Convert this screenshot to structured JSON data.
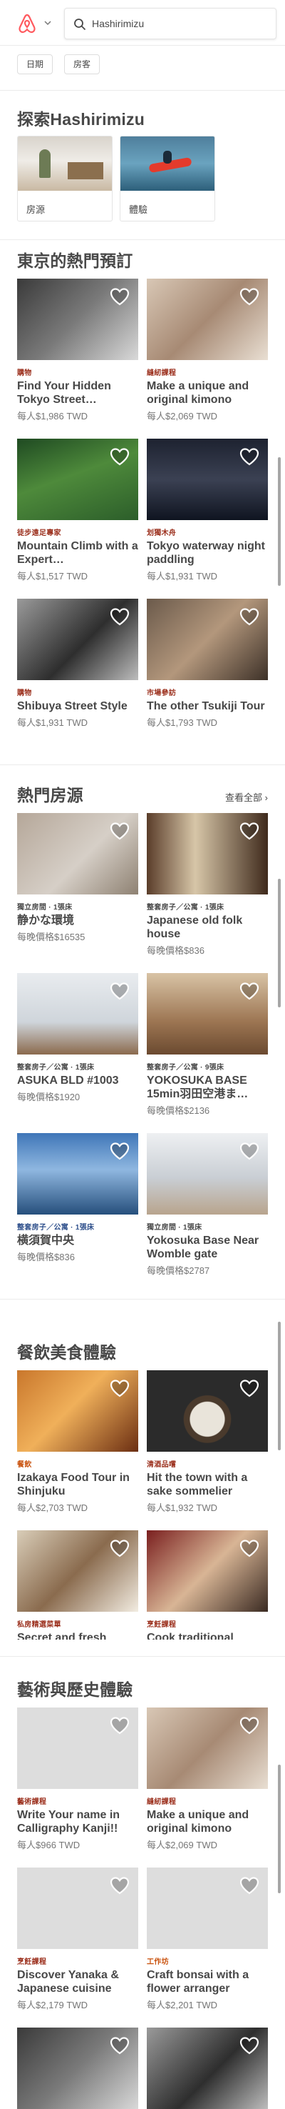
{
  "search": {
    "value": "Hashirimizu",
    "placeholder": ""
  },
  "filters": [
    {
      "label": "日期"
    },
    {
      "label": "房客"
    }
  ],
  "explore": {
    "title": "探索Hashirimizu",
    "categories": [
      {
        "label": "房源"
      },
      {
        "label": "體驗"
      }
    ]
  },
  "popular": {
    "title": "東京的熱門預訂",
    "cards": [
      {
        "label": "購物",
        "title": "Find Your Hidden Tokyo Street…",
        "price": "每人$1,986 TWD"
      },
      {
        "label": "縫紉課程",
        "title": "Make a unique and original kimono",
        "price": "每人$2,069 TWD"
      },
      {
        "label": "徒步遠足專家",
        "title": "Mountain Climb with a Expert…",
        "price": "每人$1,517 TWD"
      },
      {
        "label": "划獨木舟",
        "title": "Tokyo waterway night paddling",
        "price": "每人$1,931 TWD"
      },
      {
        "label": "購物",
        "title": "Shibuya Street Style",
        "price": "每人$1,931 TWD"
      },
      {
        "label": "市場參訪",
        "title": "The other Tsukiji Tour",
        "price": "每人$1,793 TWD"
      }
    ]
  },
  "homes": {
    "title": "熱門房源",
    "see_all": "查看全部",
    "cards": [
      {
        "label": "獨立房間 · 1張床",
        "title": "静かな環境",
        "price": "每晚價格$16535"
      },
      {
        "label": "整套房子／公寓 · 1張床",
        "title": "Japanese old folk house",
        "price": "每晚價格$836"
      },
      {
        "label": "整套房子／公寓 · 1張床",
        "title": "ASUKA BLD #1003",
        "price": "每晚價格$1920"
      },
      {
        "label": "整套房子／公寓 · 9張床",
        "title": "YOKOSUKA BASE 15min羽田空港ま…",
        "price": "每晚價格$2136"
      },
      {
        "label": "整套房子／公寓 · 1張床",
        "title": "横須賀中央",
        "price": "每晚價格$836"
      },
      {
        "label": "獨立房間 · 1張床",
        "title": "Yokosuka Base Near Womble gate",
        "price": "每晚價格$2787"
      }
    ]
  },
  "food": {
    "title": "餐飲美食體驗",
    "cards": [
      {
        "label": "餐飲",
        "title": "Izakaya Food Tour in Shinjuku",
        "price": "每人$2,703 TWD"
      },
      {
        "label": "清酒品嚐",
        "title": "Hit the town with a sake sommelier",
        "price": "每人$1,932 TWD"
      },
      {
        "label": "私房精選菜單",
        "title": "Secret and fresh",
        "price": ""
      },
      {
        "label": "烹飪課程",
        "title": "Cook traditional",
        "price": ""
      }
    ]
  },
  "arts": {
    "title": "藝術與歷史體驗",
    "cards": [
      {
        "label": "藝術課程",
        "title": "Write Your name in Calligraphy Kanji!!",
        "price": "每人$966 TWD"
      },
      {
        "label": "縫紉課程",
        "title": "Make a unique and original kimono",
        "price": "每人$2,069 TWD"
      },
      {
        "label": "烹飪課程",
        "title": "Discover Yanaka & Japanese cuisine",
        "price": "每人$2,179 TWD"
      },
      {
        "label": "工作坊",
        "title": "Craft bonsai with a flower arranger",
        "price": "每人$2,201 TWD"
      }
    ]
  },
  "colors": {
    "brand": "#ff5a5f",
    "experience_label": "#9b2f1c",
    "home_label": "#2e4f8b"
  },
  "icons": [
    "airbnb-logo-icon",
    "chevron-down-icon",
    "search-icon",
    "heart-icon",
    "chevron-right-icon"
  ]
}
